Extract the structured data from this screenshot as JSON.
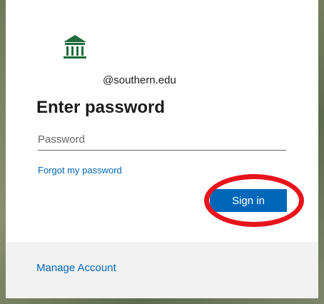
{
  "login": {
    "logo_icon": "university-building-icon",
    "email": "@southern.edu",
    "title": "Enter password",
    "password_placeholder": "Password",
    "password_value": "",
    "forgot_link": "Forgot my password",
    "signin_button": "Sign in"
  },
  "footer": {
    "manage_link": "Manage Account"
  },
  "colors": {
    "accent": "#0067b8",
    "highlight_ring": "#e8141b",
    "logo_green": "#1f6b3a"
  }
}
